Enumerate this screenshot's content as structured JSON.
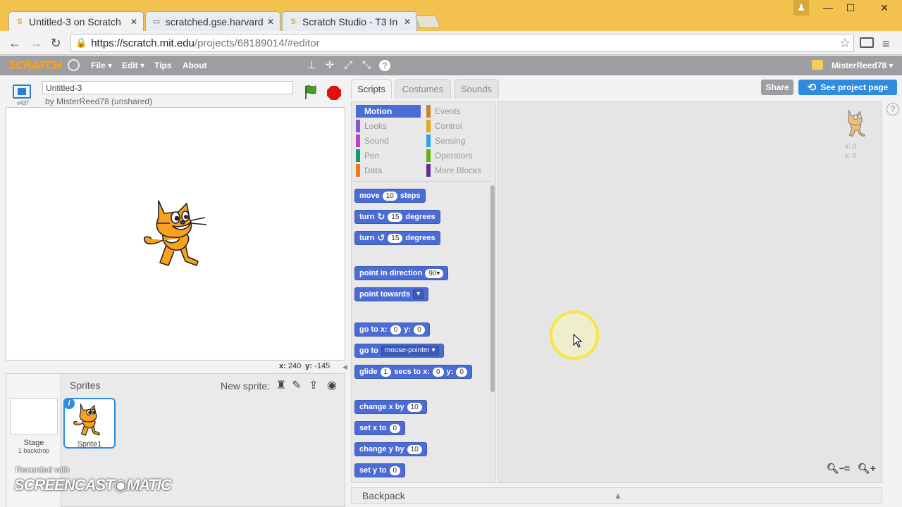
{
  "browser": {
    "tabs": [
      {
        "title": "Untitled-3 on Scratch",
        "icon": "scratch-icon",
        "active": true
      },
      {
        "title": "scratched.gse.harvard",
        "icon": "page-icon",
        "active": false
      },
      {
        "title": "Scratch Studio - T3 In",
        "icon": "scratch-icon",
        "active": false
      }
    ],
    "url": {
      "host": "https://scratch.mit.edu",
      "path": "/projects/68189014/#editor"
    }
  },
  "menubar": {
    "logo": "SCRATCH",
    "file": "File ▾",
    "edit": "Edit ▾",
    "tips": "Tips",
    "about": "About",
    "username": "MisterReed78 ▾"
  },
  "stage": {
    "version": "v437",
    "project_title": "Untitled-3",
    "byline": "by MisterReed78 (unshared)",
    "mouse_x_label": "x:",
    "mouse_x": "240",
    "mouse_y_label": "y:",
    "mouse_y": "-145"
  },
  "sprites": {
    "heading": "Sprites",
    "new_sprite_label": "New sprite:",
    "stage_label": "Stage",
    "backdrop_count": "1 backdrop",
    "sprite_name": "Sprite1",
    "sprite_info": "i"
  },
  "editor": {
    "tabs": [
      "Scripts",
      "Costumes",
      "Sounds"
    ],
    "share": "Share",
    "see_project": "See project page",
    "categories_left": [
      {
        "label": "Motion",
        "color": "#4a6cd4",
        "selected": true
      },
      {
        "label": "Looks",
        "color": "#8a55d7"
      },
      {
        "label": "Sound",
        "color": "#bb42c3"
      },
      {
        "label": "Pen",
        "color": "#0e9a6c"
      },
      {
        "label": "Data",
        "color": "#ee7d16"
      }
    ],
    "categories_right": [
      {
        "label": "Events",
        "color": "#c88330"
      },
      {
        "label": "Control",
        "color": "#e1a91a"
      },
      {
        "label": "Sensing",
        "color": "#2ca5e2"
      },
      {
        "label": "Operators",
        "color": "#5cb712"
      },
      {
        "label": "More Blocks",
        "color": "#632d99"
      }
    ],
    "blocks": {
      "move": {
        "a": "move",
        "v": "10",
        "b": "steps"
      },
      "turn_right": {
        "a": "turn",
        "icon": "↻",
        "v": "15",
        "b": "degrees"
      },
      "turn_left": {
        "a": "turn",
        "icon": "↺",
        "v": "15",
        "b": "degrees"
      },
      "point_dir": {
        "a": "point in direction",
        "v": "90▾"
      },
      "point_towards": {
        "a": "point towards",
        "v": "▾"
      },
      "goto_xy": {
        "a": "go to x:",
        "x": "0",
        "b": "y:",
        "y": "0"
      },
      "goto": {
        "a": "go to",
        "v": "mouse-pointer ▾"
      },
      "glide": {
        "a": "glide",
        "v": "1",
        "b": "secs to x:",
        "x": "0",
        "c": "y:",
        "y": "0"
      },
      "change_x": {
        "a": "change x by",
        "v": "10"
      },
      "set_x": {
        "a": "set x to",
        "v": "0"
      },
      "change_y": {
        "a": "change y by",
        "v": "10"
      },
      "set_y": {
        "a": "set y to",
        "v": "0"
      }
    },
    "sprite_x": "x: 0",
    "sprite_y": "y: 0",
    "backpack": "Backpack"
  },
  "watermark": {
    "line1": "Recorded with",
    "line2": "SCREENCAST◉MATIC"
  }
}
